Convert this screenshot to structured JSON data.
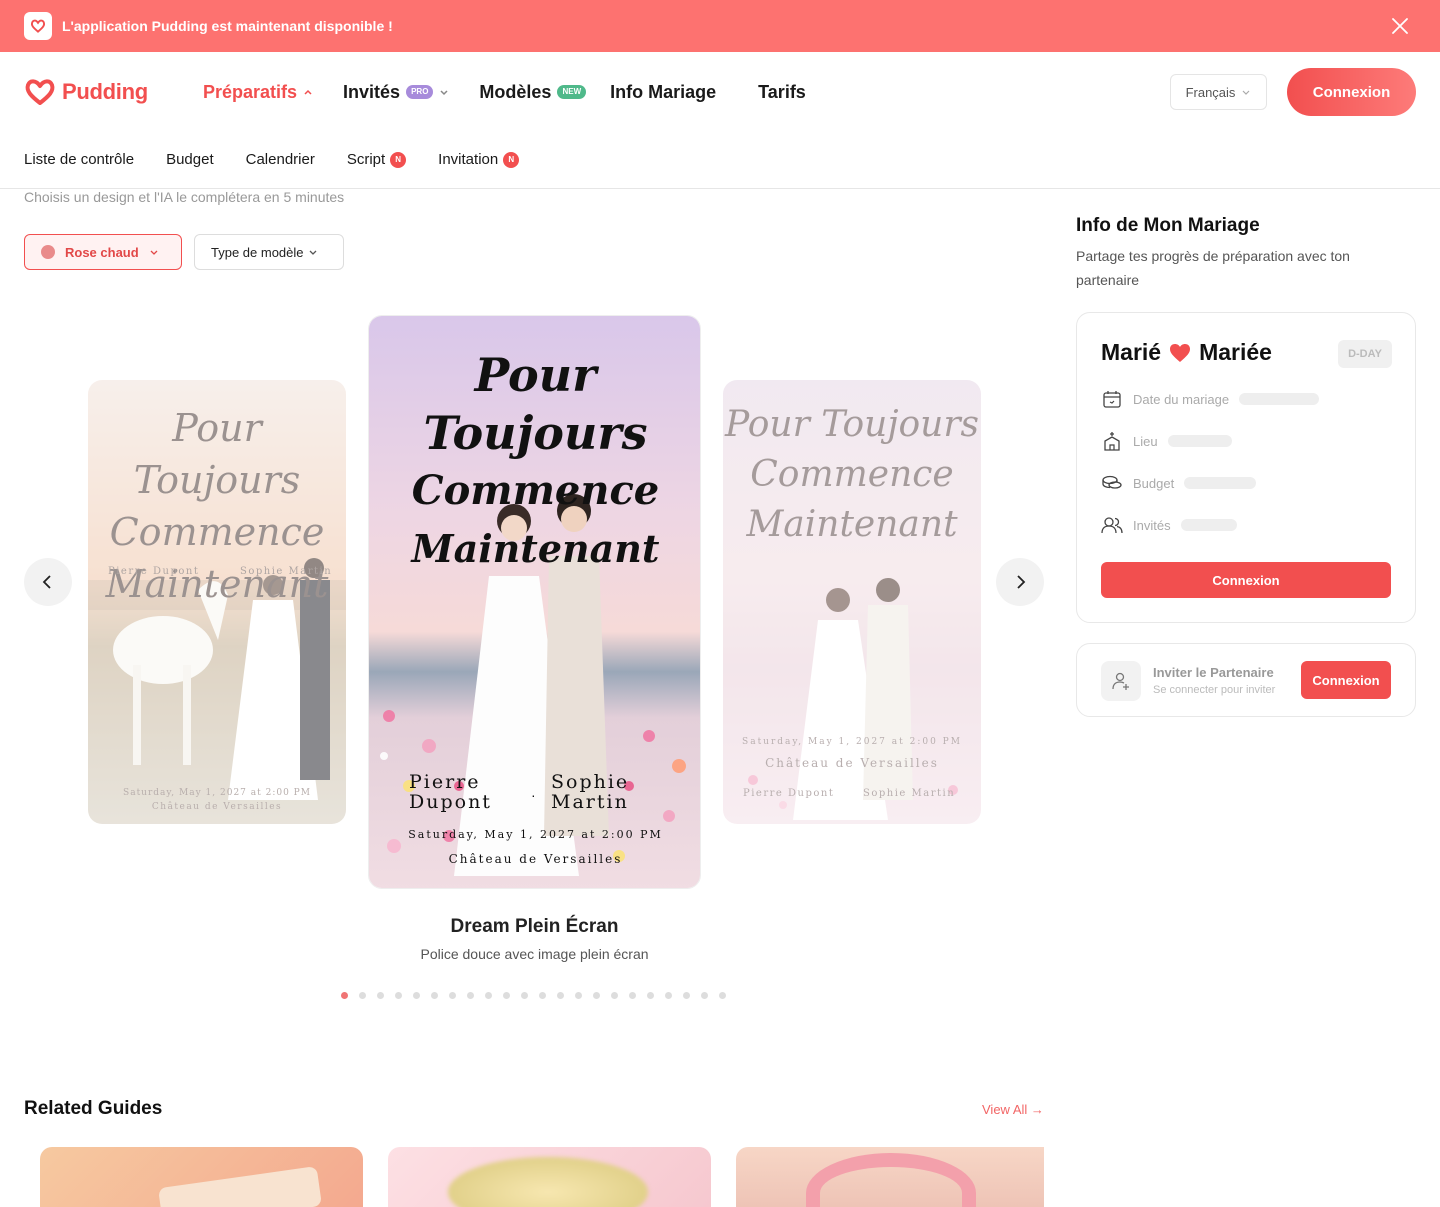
{
  "banner": {
    "text": "L'application Pudding est maintenant disponible !"
  },
  "header": {
    "logo": "Pudding",
    "nav": [
      {
        "label": "Préparatifs",
        "active": true
      },
      {
        "label": "Invités",
        "badge": "PRO"
      },
      {
        "label": "Modèles",
        "badge": "NEW"
      },
      {
        "label": "Info Mariage"
      },
      {
        "label": "Tarifs"
      }
    ],
    "language": "Français",
    "login": "Connexion"
  },
  "subnav": {
    "items": [
      {
        "label": "Liste de contrôle"
      },
      {
        "label": "Budget"
      },
      {
        "label": "Calendrier"
      },
      {
        "label": "Script",
        "badge": "N"
      },
      {
        "label": "Invitation",
        "badge": "N"
      }
    ]
  },
  "main": {
    "subtitle": "Choisis un design et l'IA le complétera en 5 minutes",
    "filter_color": "Rose chaud",
    "filter_type": "Type de modèle",
    "cards": {
      "left": {
        "script": [
          "Pour Toujours",
          "Commence",
          "Maintenant"
        ],
        "groom": "Pierre Dupont",
        "bride": "Sophie Martin",
        "date": "Saturday, May 1, 2027 at 2:00 PM",
        "venue": "Château de Versailles"
      },
      "center": {
        "script": [
          "Pour",
          "Toujours",
          "Commence",
          "Maintenant"
        ],
        "groom_first": "Pierre",
        "groom_last": "Dupont",
        "bride_first": "Sophie",
        "bride_last": "Martin",
        "date": "Saturday, May 1, 2027 at 2:00 PM",
        "venue": "Château de Versailles"
      },
      "right": {
        "script": [
          "Pour Toujours",
          "Commence",
          "Maintenant"
        ],
        "date": "Saturday, May 1, 2027 at 2:00 PM",
        "venue": "Château de Versailles",
        "groom": "Pierre Dupont",
        "bride": "Sophie Martin"
      }
    },
    "template_title": "Dream Plein Écran",
    "template_desc": "Police douce avec image plein écran",
    "dots_total": 22,
    "dots_active_index": 0,
    "related_title": "Related Guides",
    "view_all": "View All →"
  },
  "sidebar": {
    "title": "Info de Mon Mariage",
    "desc": "Partage tes progrès de préparation avec ton partenaire",
    "groom": "Marié",
    "bride": "Mariée",
    "dday": "D-DAY",
    "rows": [
      "Date du mariage",
      "Lieu",
      "Budget",
      "Invités"
    ],
    "login": "Connexion",
    "invite_title": "Inviter le Partenaire",
    "invite_sub": "Se connecter pour inviter",
    "invite_login": "Connexion"
  },
  "colors": {
    "accent": "#f24f4f",
    "banner": "#fd7270"
  }
}
